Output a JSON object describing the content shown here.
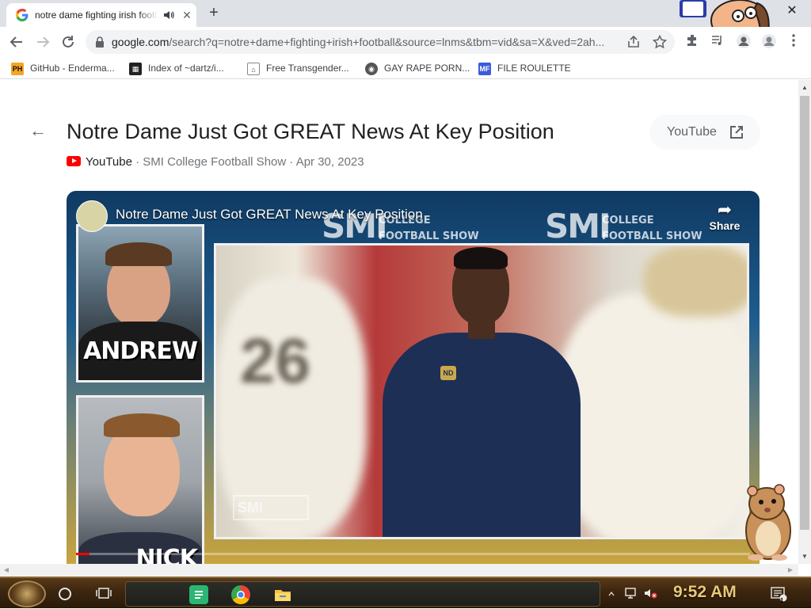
{
  "browser": {
    "tab": {
      "title": "notre dame fighting irish football",
      "close_label": "✕"
    },
    "new_tab_label": "+",
    "window_close_label": "✕",
    "url_host": "google.com",
    "url_rest": "/search?q=notre+dame+fighting+irish+football&source=lnms&tbm=vid&sa=X&ved=2ah...",
    "bookmarks": [
      {
        "label": "GitHub - Enderma...",
        "icon_text": "PH",
        "icon_color": "#f5a623"
      },
      {
        "label": "Index of ~dartz/i...",
        "icon_text": "▦",
        "icon_color": "#222222"
      },
      {
        "label": "Free Transgender...",
        "icon_text": "⌂",
        "icon_color": "#444444"
      },
      {
        "label": "GAY RAPE PORN...",
        "icon_text": "◉",
        "icon_color": "#555555"
      },
      {
        "label": "FILE ROULETTE",
        "icon_text": "MF",
        "icon_color": "#3b5bdb"
      }
    ]
  },
  "page": {
    "back_label": "←",
    "video_title": "Notre Dame Just Got GREAT News At Key Position",
    "youtube_button_label": "YouTube",
    "source": "YouTube",
    "meta": " · SMI College Football Show · Apr 30, 2023"
  },
  "player": {
    "title": "Notre Dame Just Got GREAT News At Key Position",
    "share_label": "Share",
    "banner_big": "SMI",
    "banner_small": "COLLEGE FOOTBALL SHOW",
    "cam_top_name": "ANDREW",
    "cam_bottom_name": "NICK",
    "watermark": "SMI",
    "jersey_number": "26",
    "logo_text": "ND",
    "progress_fraction": 0.02
  },
  "taskbar": {
    "clock": "9:52 AM",
    "notif_badge": "1"
  },
  "colors": {
    "accent": "#1a73e8",
    "youtube_red": "#ff0000",
    "clock_gold": "#e8c878"
  }
}
